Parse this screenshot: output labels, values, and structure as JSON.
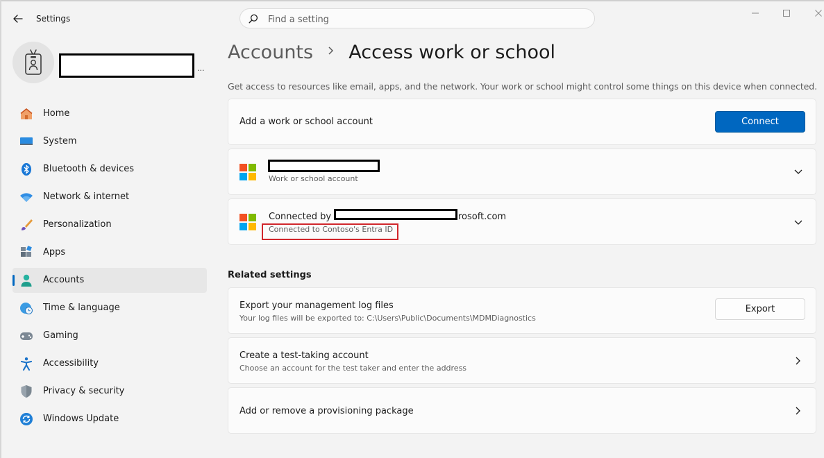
{
  "app": {
    "title": "Settings"
  },
  "search": {
    "placeholder": "Find a setting"
  },
  "profile": {
    "name_suffix": "..."
  },
  "nav": {
    "items": [
      {
        "label": "Home",
        "icon": "home-icon"
      },
      {
        "label": "System",
        "icon": "system-icon"
      },
      {
        "label": "Bluetooth & devices",
        "icon": "bluetooth-icon"
      },
      {
        "label": "Network & internet",
        "icon": "wifi-icon"
      },
      {
        "label": "Personalization",
        "icon": "brush-icon"
      },
      {
        "label": "Apps",
        "icon": "apps-icon"
      },
      {
        "label": "Accounts",
        "icon": "accounts-icon",
        "selected": true
      },
      {
        "label": "Time & language",
        "icon": "globe-clock-icon"
      },
      {
        "label": "Gaming",
        "icon": "gamepad-icon"
      },
      {
        "label": "Accessibility",
        "icon": "accessibility-icon"
      },
      {
        "label": "Privacy & security",
        "icon": "shield-icon"
      },
      {
        "label": "Windows Update",
        "icon": "update-icon"
      }
    ]
  },
  "breadcrumb": {
    "parent": "Accounts",
    "current": "Access work or school"
  },
  "description": "Get access to resources like email, apps, and the network. Your work or school might control some things on this device when connected.",
  "add_account": {
    "label": "Add a work or school account",
    "button": "Connect"
  },
  "accounts": [
    {
      "subtitle": "Work or school account"
    },
    {
      "title_prefix": "Connected by L",
      "title_suffix": "rosoft.com",
      "subtitle": "Connected to Contoso's Entra ID"
    }
  ],
  "related": {
    "title": "Related settings",
    "export": {
      "title": "Export your management log files",
      "subtitle": "Your log files will be exported to: C:\\Users\\Public\\Documents\\MDMDiagnostics",
      "button": "Export"
    },
    "test_account": {
      "title": "Create a test-taking account",
      "subtitle": "Choose an account for the test taker and enter the address"
    },
    "provisioning": {
      "title": "Add or remove a provisioning package"
    }
  },
  "colors": {
    "accent": "#0067c0",
    "highlight": "#d1262b",
    "ms_red": "#f25022",
    "ms_green": "#7fba00",
    "ms_blue": "#00a4ef",
    "ms_yellow": "#ffb900"
  }
}
